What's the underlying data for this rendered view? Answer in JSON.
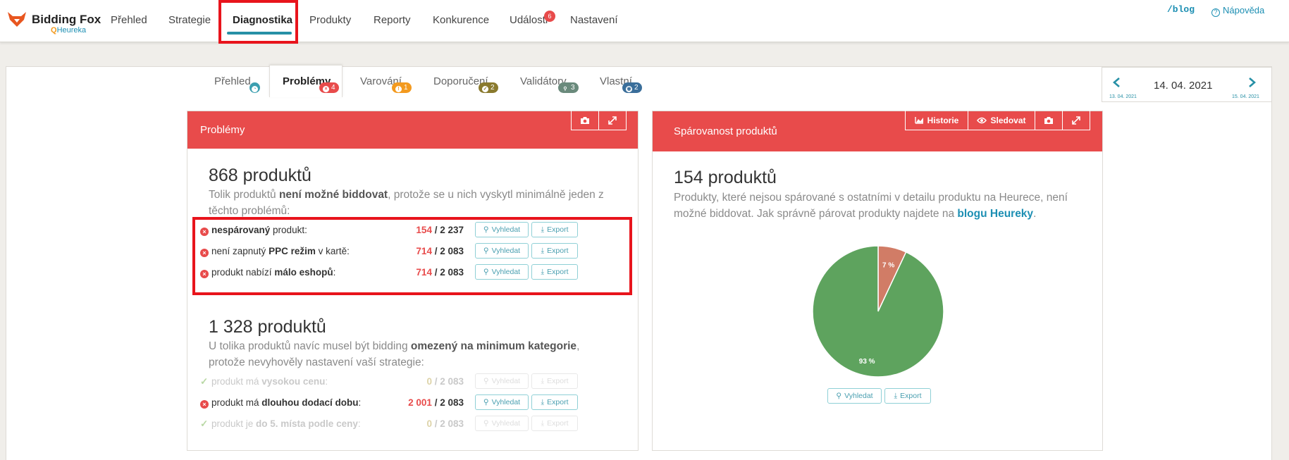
{
  "app": {
    "brand": "Bidding Fox",
    "brand_sub": "Heureka"
  },
  "nav": {
    "items": [
      {
        "label": "Přehled"
      },
      {
        "label": "Strategie"
      },
      {
        "label": "Diagnostika"
      },
      {
        "label": "Produkty"
      },
      {
        "label": "Reporty"
      },
      {
        "label": "Konkurence"
      },
      {
        "label": "Události",
        "badge": "6"
      },
      {
        "label": "Nastavení"
      }
    ],
    "active": "Diagnostika",
    "blog": "/blog",
    "help": "Nápověda"
  },
  "subtabs": [
    {
      "label": "Přehled",
      "badge": "",
      "badge_color": "#3c9fb0",
      "icon": "gauge-icon"
    },
    {
      "label": "Problémy",
      "badge": "4",
      "badge_color": "#e84b4b",
      "icon": "x-circle-icon"
    },
    {
      "label": "Varování",
      "badge": "1",
      "badge_color": "#f39a1f",
      "icon": "warning-icon"
    },
    {
      "label": "Doporučení",
      "badge": "2",
      "badge_color": "#8a7a2e",
      "icon": "check-circle-icon"
    },
    {
      "label": "Validátory",
      "badge": "3",
      "badge_color": "#6a8a7c",
      "icon": "search-icon"
    },
    {
      "label": "Vlastní",
      "badge": "2",
      "badge_color": "#3a6e9a",
      "icon": "eye-icon"
    }
  ],
  "date": {
    "current": "14. 04. 2021",
    "prev": "13. 04. 2021",
    "next": "15. 04. 2021"
  },
  "problems_panel": {
    "title": "Problémy",
    "section1": {
      "count": "868 produktů",
      "desc_prefix": "Tolik produktů ",
      "desc_bold": "není možné biddovat",
      "desc_suffix": ", protože se u nich vyskytl minimálně jeden z těchto problémů:",
      "rows": [
        {
          "pre": "",
          "bold": "nespárovaný",
          "post": " produkt:",
          "num": "154",
          "total": " / 2 237",
          "dim": false
        },
        {
          "pre": "není zapnutý ",
          "bold": "PPC režim",
          "post": " v kartě:",
          "num": "714",
          "total": " / 2 083",
          "dim": false
        },
        {
          "pre": "produkt nabízí ",
          "bold": "málo eshopů",
          "post": ":",
          "num": "714",
          "total": " / 2 083",
          "dim": false
        }
      ]
    },
    "section2": {
      "count": "1 328 produktů",
      "desc_prefix": "U tolika produktů navíc musel být bidding ",
      "desc_bold": "omezený na minimum kategorie",
      "desc_suffix": ", protože nevyhověly nastavení vaší strategie:",
      "rows": [
        {
          "pre": "produkt má ",
          "bold": "vysokou cenu",
          "post": ":",
          "num": "0",
          "total": " / 2 083",
          "dim": true
        },
        {
          "pre": "produkt má ",
          "bold": "dlouhou dodací dobu",
          "post": ":",
          "num": "2 001",
          "total": " / 2 083",
          "dim": false
        },
        {
          "pre": "produkt je ",
          "bold": "do 5. místa podle ceny",
          "post": ":",
          "num": "0",
          "total": " / 2 083",
          "dim": true
        }
      ]
    },
    "search_label": "Vyhledat",
    "export_label": "Export"
  },
  "pairing_panel": {
    "title": "Spárovanost produktů",
    "history_label": "Historie",
    "follow_label": "Sledovat",
    "count": "154 produktů",
    "desc_text": "Produkty, které nejsou spárované s ostatními v detailu produktu na Heurece, není možné biddovat. Jak správně párovat produkty najdete na ",
    "desc_link": "blogu Heureky",
    "desc_end": ".",
    "search_label": "Vyhledat",
    "export_label": "Export"
  },
  "chart_data": {
    "type": "pie",
    "title": "",
    "slices": [
      {
        "label": "7 %",
        "value": 7,
        "color": "#d17c66"
      },
      {
        "label": "93 %",
        "value": 93,
        "color": "#5ea35e"
      }
    ]
  }
}
